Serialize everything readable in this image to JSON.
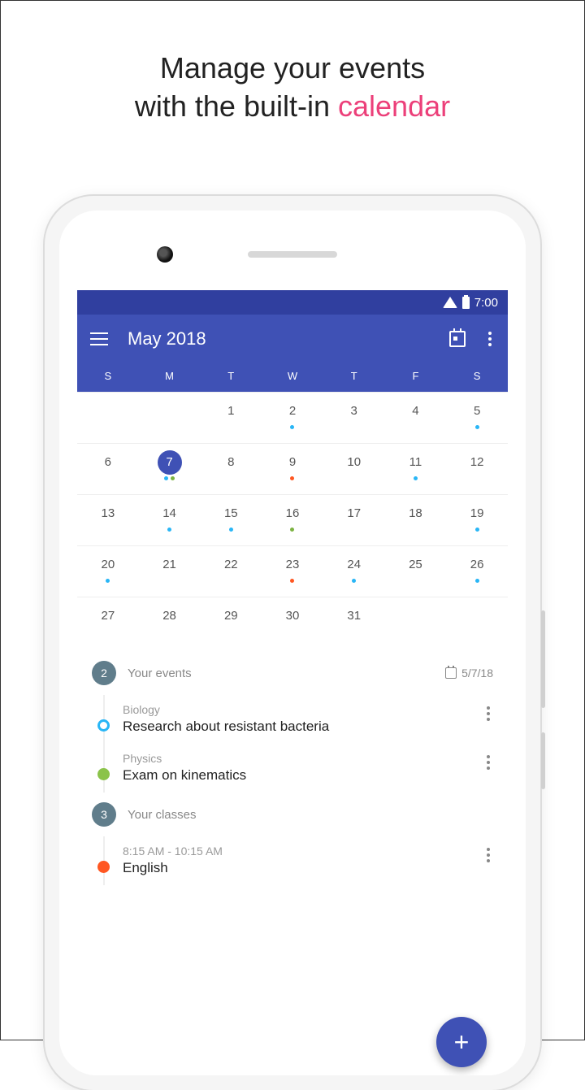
{
  "promo": {
    "line1": "Manage your events",
    "line2_a": "with the built-in ",
    "line2_b": "calendar"
  },
  "status": {
    "time": "7:00"
  },
  "appbar": {
    "title": "May 2018"
  },
  "weekdays": [
    "S",
    "M",
    "T",
    "W",
    "T",
    "F",
    "S"
  ],
  "weeks": [
    [
      {},
      {},
      {
        "n": "1"
      },
      {
        "n": "2",
        "dots": [
          "b"
        ]
      },
      {
        "n": "3"
      },
      {
        "n": "4"
      },
      {
        "n": "5",
        "dots": [
          "b"
        ]
      }
    ],
    [
      {
        "n": "6"
      },
      {
        "n": "7",
        "sel": true,
        "dots": [
          "b",
          "g"
        ]
      },
      {
        "n": "8"
      },
      {
        "n": "9",
        "dots": [
          "o"
        ]
      },
      {
        "n": "10"
      },
      {
        "n": "11",
        "dots": [
          "b"
        ]
      },
      {
        "n": "12"
      }
    ],
    [
      {
        "n": "13"
      },
      {
        "n": "14",
        "dots": [
          "b"
        ]
      },
      {
        "n": "15",
        "dots": [
          "b"
        ]
      },
      {
        "n": "16",
        "dots": [
          "g"
        ]
      },
      {
        "n": "17"
      },
      {
        "n": "18"
      },
      {
        "n": "19",
        "dots": [
          "b"
        ]
      }
    ],
    [
      {
        "n": "20",
        "dots": [
          "b"
        ]
      },
      {
        "n": "21"
      },
      {
        "n": "22"
      },
      {
        "n": "23",
        "dots": [
          "o"
        ]
      },
      {
        "n": "24",
        "dots": [
          "b"
        ]
      },
      {
        "n": "25"
      },
      {
        "n": "26",
        "dots": [
          "b"
        ]
      }
    ],
    [
      {
        "n": "27"
      },
      {
        "n": "28"
      },
      {
        "n": "29"
      },
      {
        "n": "30"
      },
      {
        "n": "31"
      },
      {},
      {}
    ]
  ],
  "events_section": {
    "count": "2",
    "label": "Your events",
    "date": "5/7/18"
  },
  "events": [
    {
      "over": "Biology",
      "title": "Research about resistant bacteria",
      "bullet": "ring"
    },
    {
      "over": "Physics",
      "title": "Exam on kinematics",
      "bullet": "green"
    }
  ],
  "classes_section": {
    "count": "3",
    "label": "Your classes"
  },
  "classes": [
    {
      "over": "8:15 AM - 10:15 AM",
      "title": "English",
      "bullet": "orange"
    }
  ],
  "fab": "+"
}
